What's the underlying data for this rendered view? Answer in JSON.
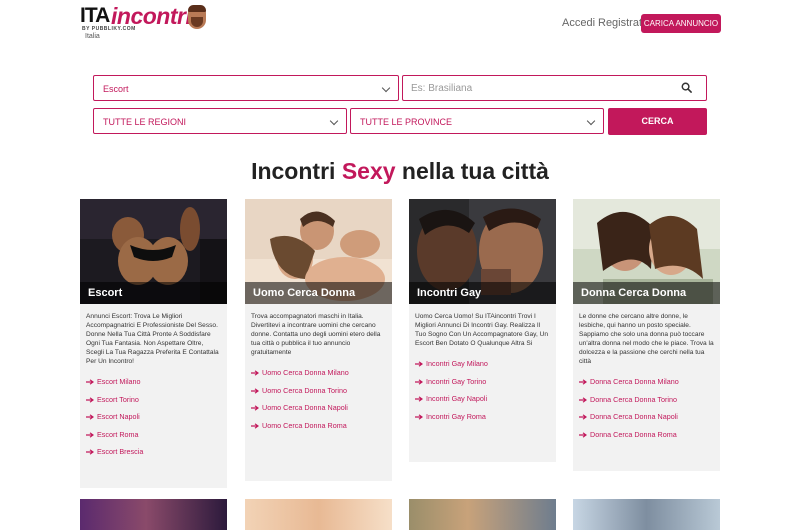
{
  "header": {
    "logo_ita": "ITA",
    "logo_incontri": "incontri",
    "logo_by": "BY PUBBLIKY.COM",
    "logo_sub": "Italia",
    "nav": {
      "accedi": "Accedi",
      "registrati": "Registrati"
    },
    "carica_label": "CARICA ANNUNCIO"
  },
  "search": {
    "category_value": "Escort",
    "keyword_placeholder": "Es: Brasiliana",
    "region_value": "TUTTE LE REGIONI",
    "province_value": "TUTTE LE PROVINCE",
    "submit_label": "CERCA"
  },
  "title": {
    "pre": "Incontri ",
    "accent": "Sexy",
    "post": " nella tua città"
  },
  "colors": {
    "accent": "#c2185b"
  },
  "cards": [
    {
      "title": "Escort",
      "desc": "Annunci Escort: Trova Le Migliori Accompagnatrici E Professioniste Del Sesso. Donne Nella Tua Città Pronte A Soddisfare Ogni Tua Fantasia. Non Aspettare Oltre, Scegli La Tua Ragazza Preferita E Contattala Per Un Incontro!",
      "links": [
        "Escort Milano",
        "Escort Torino",
        "Escort Napoli",
        "Escort Roma",
        "Escort Brescia"
      ]
    },
    {
      "title": "Uomo Cerca Donna",
      "desc": "Trova accompagnatori maschi in Italia. Divertitevi a incontrare uomini che cercano donne. Contatta uno degli uomini etero della tua città o pubblica il tuo annuncio gratuitamente",
      "links": [
        "Uomo Cerca Donna Milano",
        "Uomo Cerca Donna Torino",
        "Uomo Cerca Donna Napoli",
        "Uomo Cerca Donna Roma"
      ]
    },
    {
      "title": "Incontri Gay",
      "desc": "Uomo Cerca Uomo! Su ITAincontri Trovi I Migliori Annunci Di Incontri Gay. Realizza Il Tuo Sogno Con Un Accompagnatore Gay, Un Escort Ben Dotato O Qualunque Altra Si",
      "links": [
        "Incontri Gay Milano",
        "Incontri Gay Torino",
        "Incontri Gay Napoli",
        "Incontri Gay Roma"
      ]
    },
    {
      "title": "Donna Cerca Donna",
      "desc": "Le donne che cercano altre donne, le lesbiche, qui hanno un posto speciale. Sappiamo che solo una donna può toccare un'altra donna nel modo che le piace. Trova la dolcezza e la passione che cerchi nella tua città",
      "links": [
        "Donna Cerca Donna Milano",
        "Donna Cerca Donna Torino",
        "Donna Cerca Donna Napoli",
        "Donna Cerca Donna Roma"
      ]
    }
  ]
}
